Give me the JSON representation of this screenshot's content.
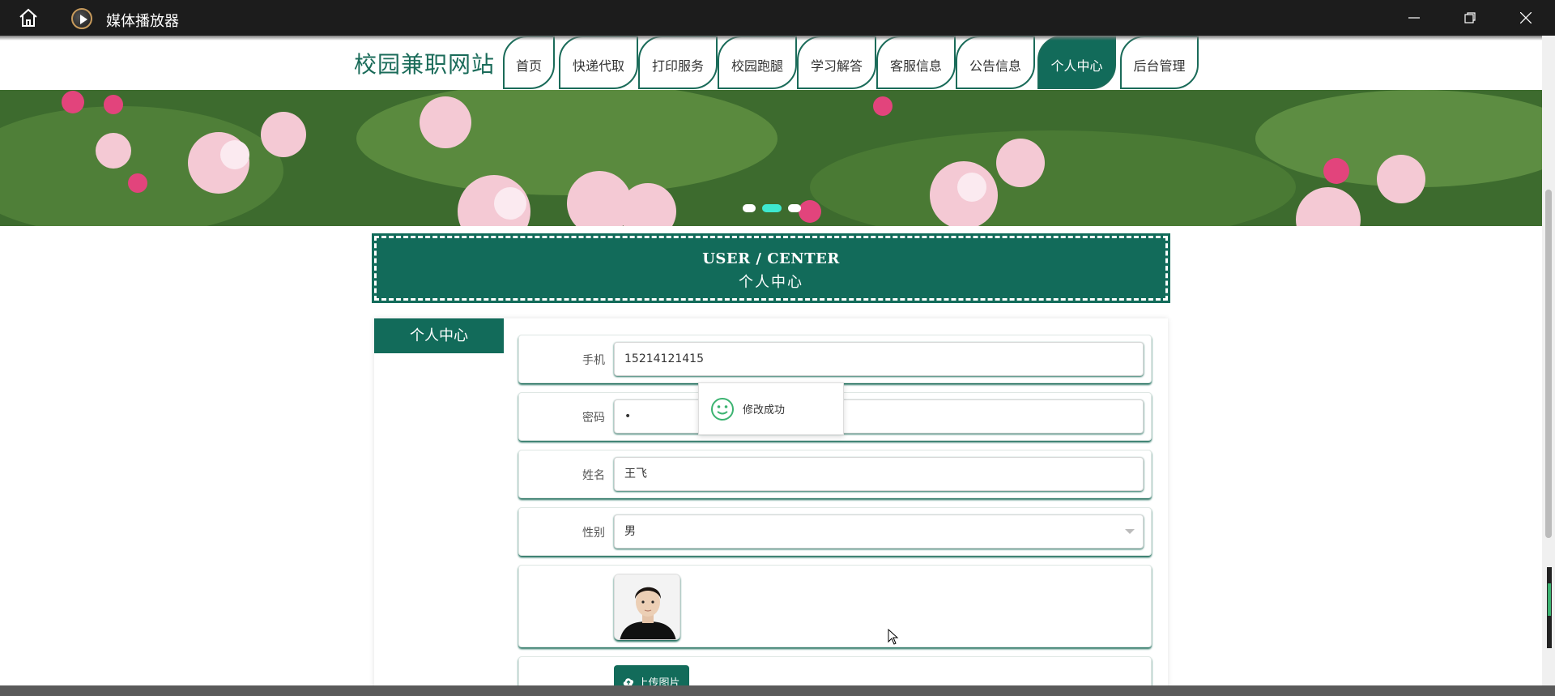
{
  "window": {
    "title": "媒体播放器"
  },
  "nav": {
    "logo": "校园兼职网站",
    "items": [
      {
        "label": "首页",
        "active": false
      },
      {
        "label": "快递代取",
        "active": false
      },
      {
        "label": "打印服务",
        "active": false
      },
      {
        "label": "校园跑腿",
        "active": false
      },
      {
        "label": "学习解答",
        "active": false
      },
      {
        "label": "客服信息",
        "active": false
      },
      {
        "label": "公告信息",
        "active": false
      },
      {
        "label": "个人中心",
        "active": true
      },
      {
        "label": "后台管理",
        "active": false
      }
    ]
  },
  "banner": {
    "slides": 3,
    "active_slide": 2
  },
  "section": {
    "en_title": "USER / CENTER",
    "cn_title": "个人中心"
  },
  "sidebar": {
    "title": "个人中心"
  },
  "form": {
    "phone": {
      "label": "手机",
      "value": "15214121415"
    },
    "password": {
      "label": "密码",
      "value": "•"
    },
    "name": {
      "label": "姓名",
      "value": "王飞"
    },
    "gender": {
      "label": "性别",
      "value": "男"
    },
    "upload_label": "上传图片"
  },
  "toast": {
    "message": "修改成功"
  },
  "colors": {
    "accent": "#126b5a",
    "titlebar": "#1c1c1c",
    "dot_active": "#3ee8d0"
  }
}
